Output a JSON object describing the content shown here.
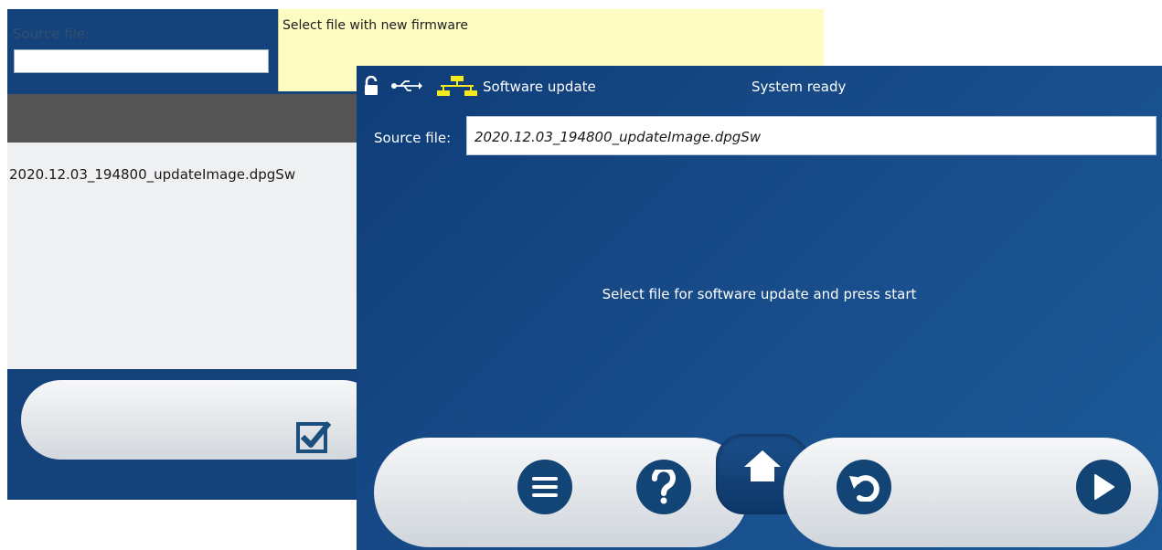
{
  "back_window": {
    "source_label": "Source file:",
    "hint_text": "Select file with new firmware",
    "file_item": "2020.12.03_194800_updateImage.dpgSw",
    "icons": [
      "checkbox-checked-icon"
    ]
  },
  "front_window": {
    "title": "Software update",
    "status": "System ready",
    "source_label": "Source file:",
    "source_value": "2020.12.03_194800_updateImage.dpgSw",
    "message": "Select file for software update and press start",
    "icons": [
      "unlock-icon",
      "usb-icon",
      "network-icon",
      "menu-icon",
      "help-icon",
      "home-icon",
      "undo-icon",
      "play-icon"
    ],
    "colors": {
      "background": "#14427a",
      "button": "#124476",
      "network_icon": "#f4ea1d",
      "hint_bg": "#fdfdc3"
    }
  }
}
